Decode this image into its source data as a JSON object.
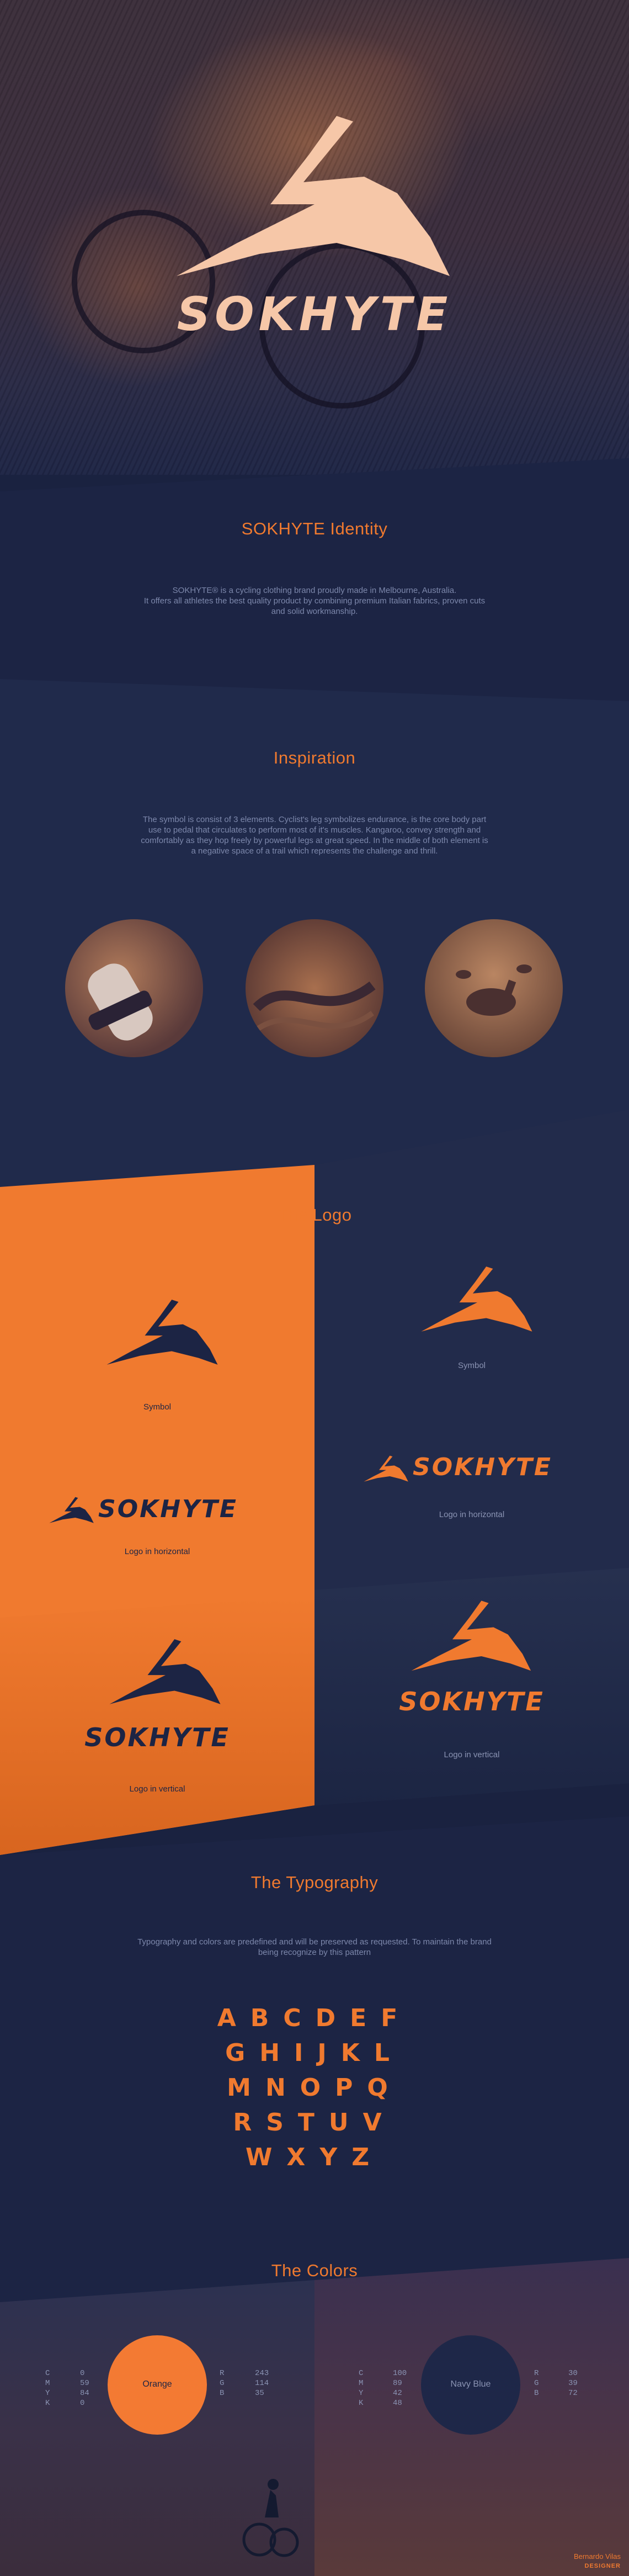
{
  "hero": {
    "brand": "SOKHYTE"
  },
  "identity": {
    "title": "SOKHYTE Identity",
    "text": "SOKHYTE® is a cycling clothing brand proudly made in Melbourne, Australia.\nIt offers all athletes the best quality product by combining premium Italian fabrics, proven cuts\nand solid workmanship."
  },
  "inspiration": {
    "title": "Inspiration",
    "text": "The symbol is consist of 3 elements. Cyclist's leg symbolizes endurance, is the core body part\nuse to pedal that circulates to perform most of it's muscles. Kangaroo, convey strength and\ncomfortably as they hop freely by powerful legs at great speed. In the middle of both element is\na negative space of a trail which represents the challenge and thrill."
  },
  "logo": {
    "title": "The Logo",
    "symbol_caption_orange": "Symbol",
    "symbol_caption_blue": "Symbol",
    "horizontal_caption_orange": "Logo in horizontal",
    "horizontal_caption_blue": "Logo in horizontal",
    "vertical_caption_orange": "Logo in vertical",
    "vertical_caption_blue": "Logo in vertical",
    "wordmark": "SOKHYTE"
  },
  "typography": {
    "title": "The Typography",
    "text": "Typography and colors are predefined and will be preserved as requested. To maintain the brand\nbeing recognize by this pattern",
    "rows": [
      "ABCDEF",
      "GHIJKL",
      "MNOPQ",
      "RSTUV",
      "WXYZ"
    ]
  },
  "colors": {
    "title": "The Colors",
    "orange": {
      "name": "Orange",
      "hex": "#f37a33",
      "cmyk_labels": [
        "C",
        "M",
        "Y",
        "K"
      ],
      "cmyk_values": [
        "0",
        "59",
        "84",
        "0"
      ],
      "rgb_labels": [
        "R",
        "G",
        "B"
      ],
      "rgb_values": [
        "243",
        "114",
        "35"
      ]
    },
    "navy": {
      "name": "Navy Blue",
      "hex": "#1e2748",
      "cmyk_labels": [
        "C",
        "M",
        "Y",
        "K"
      ],
      "cmyk_values": [
        "100",
        "89",
        "42",
        "48"
      ],
      "rgb_labels": [
        "R",
        "G",
        "B"
      ],
      "rgb_values": [
        "30",
        "39",
        "72"
      ]
    }
  },
  "footer": {
    "author": "Bernardo Vilas",
    "role": "DESIGNER"
  },
  "palette": {
    "navy": "#1c2444",
    "orange": "#f07a2f",
    "peach": "#f6c7a8"
  }
}
